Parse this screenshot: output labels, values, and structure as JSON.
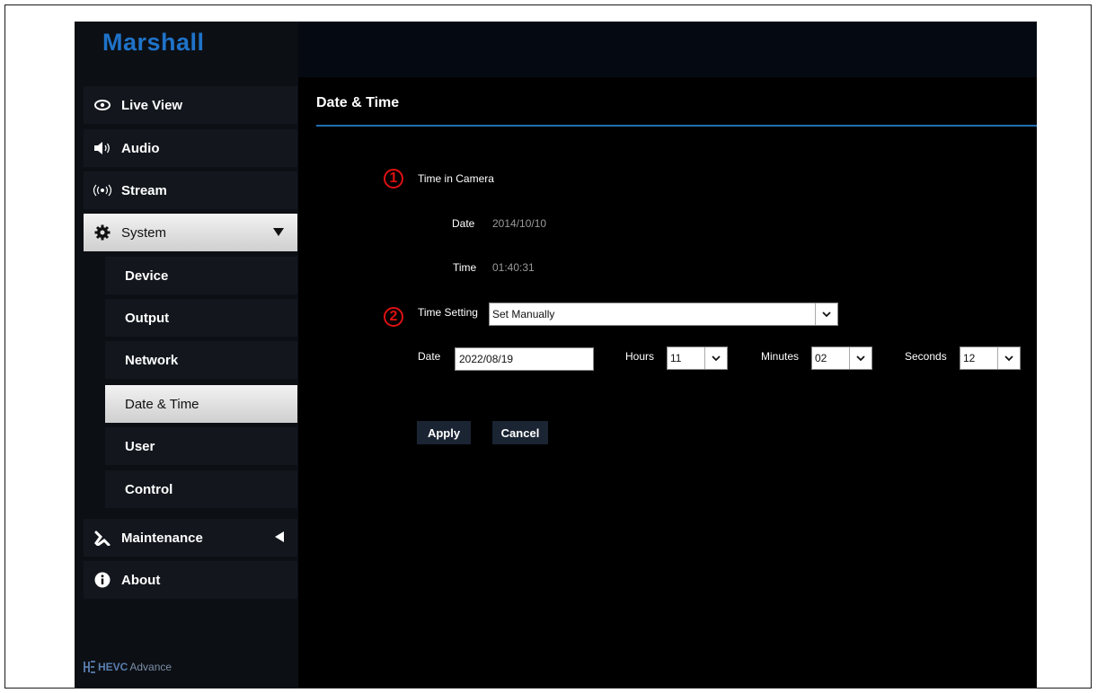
{
  "brand": "Marshall",
  "footer": {
    "hevc": "HEVC",
    "advance": "Advance"
  },
  "sidebar": {
    "items": [
      {
        "label": "Live View",
        "icon": "eye-icon"
      },
      {
        "label": "Audio",
        "icon": "speaker-icon"
      },
      {
        "label": "Stream",
        "icon": "broadcast-icon"
      },
      {
        "label": "System",
        "icon": "gear-icon"
      },
      {
        "label": "Maintenance",
        "icon": "wrench-icon"
      },
      {
        "label": "About",
        "icon": "info-icon"
      }
    ],
    "system_sub": [
      {
        "label": "Device"
      },
      {
        "label": "Output"
      },
      {
        "label": "Network"
      },
      {
        "label": "Date & Time"
      },
      {
        "label": "User"
      },
      {
        "label": "Control"
      }
    ]
  },
  "main": {
    "title": "Date & Time",
    "marker1": "1",
    "marker2": "2",
    "time_in_camera": {
      "label": "Time in Camera",
      "date_label": "Date",
      "date_value": "2014/10/10",
      "time_label": "Time",
      "time_value": "01:40:31"
    },
    "time_setting": {
      "label": "Time Setting",
      "value": "Set Manually",
      "date_label": "Date",
      "date_value": "2022/08/19",
      "hours_label": "Hours",
      "hours_value": "11",
      "minutes_label": "Minutes",
      "minutes_value": "02",
      "seconds_label": "Seconds",
      "seconds_value": "12"
    },
    "apply_label": "Apply",
    "cancel_label": "Cancel"
  },
  "colors": {
    "brand": "#1f73c9",
    "marker": "#d11111",
    "accent_line": "#1f6fb0"
  }
}
